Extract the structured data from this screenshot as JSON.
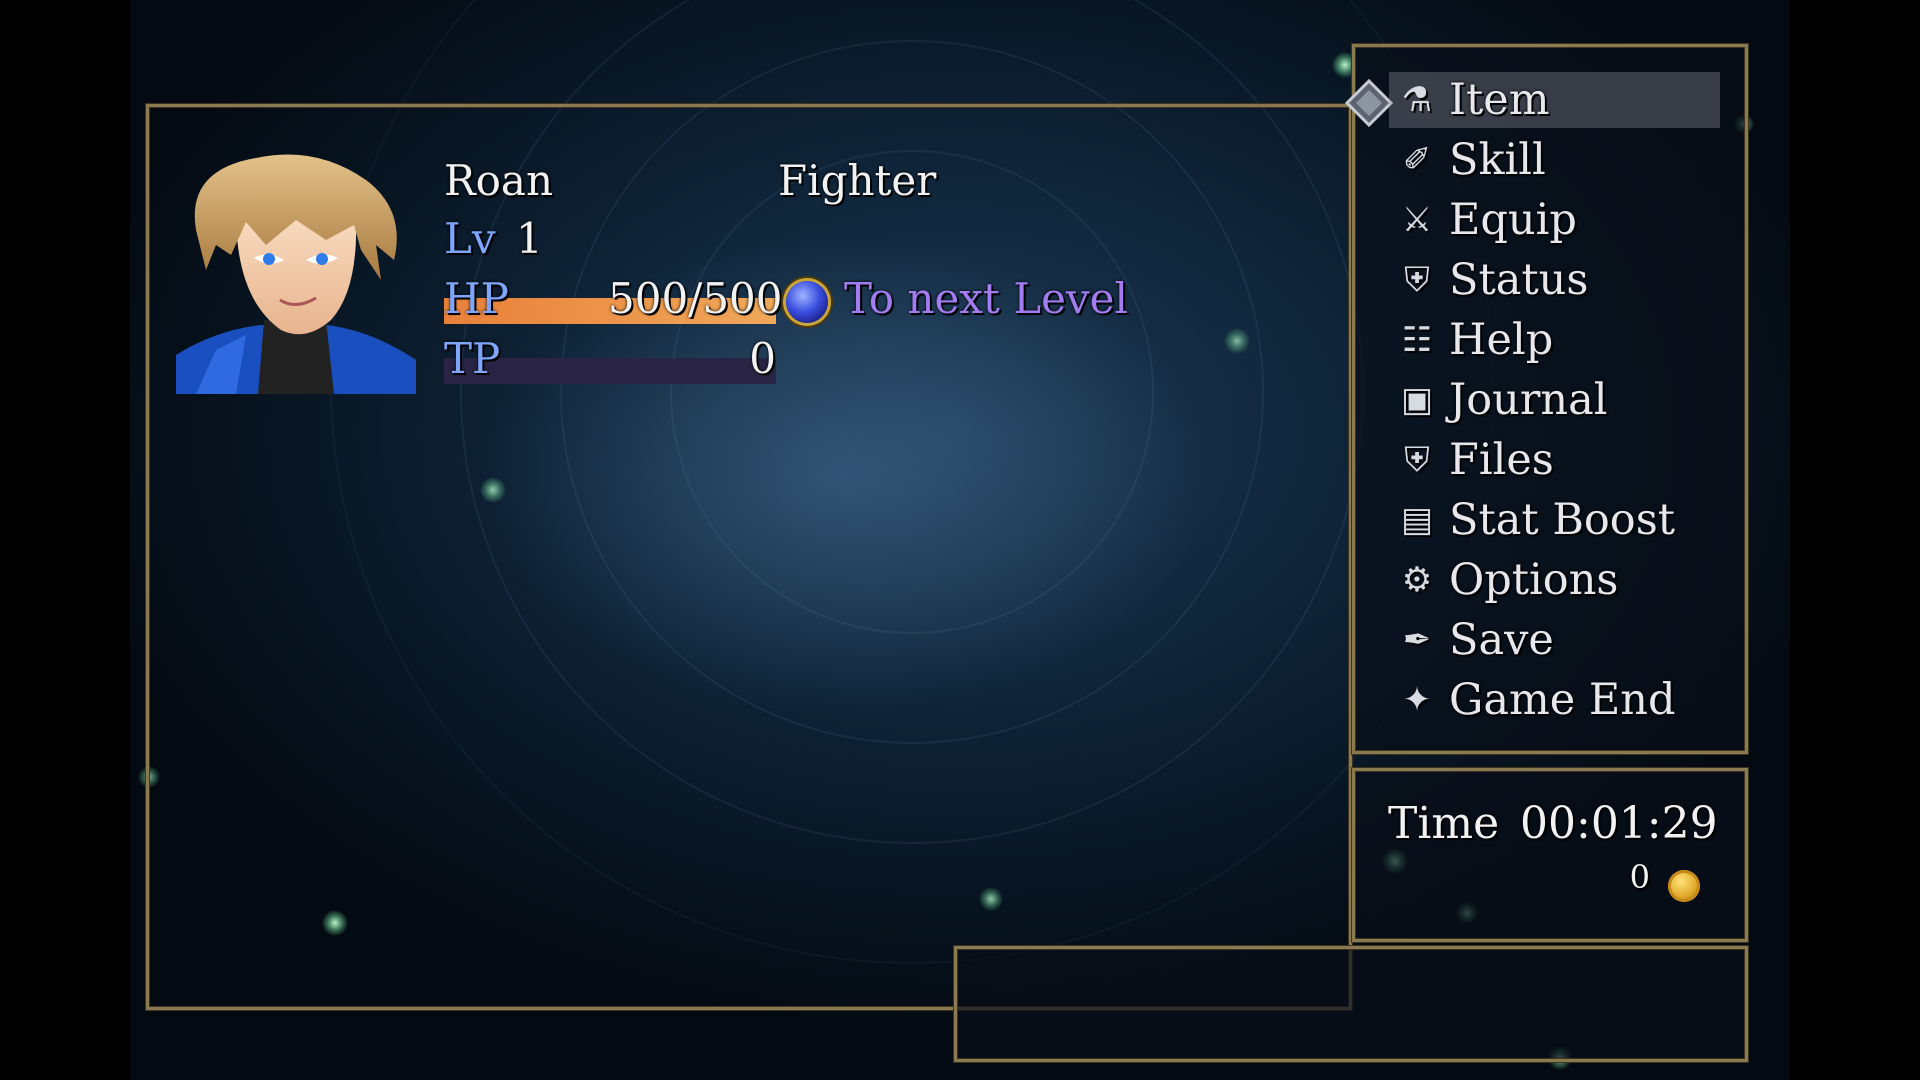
{
  "character": {
    "name": "Roan",
    "class": "Fighter",
    "level_label": "Lv",
    "level": "1",
    "hp_label": "HP",
    "hp_value": "500/500",
    "hp_fraction": 1.0,
    "tp_label": "TP",
    "tp_value": "0",
    "tp_fraction": 0.0,
    "next_level_text": "To next Level"
  },
  "menu": {
    "selected_index": 0,
    "items": [
      {
        "label": "Item",
        "icon": "potion-icon"
      },
      {
        "label": "Skill",
        "icon": "scroll-icon"
      },
      {
        "label": "Equip",
        "icon": "armor-icon"
      },
      {
        "label": "Status",
        "icon": "shield-icon"
      },
      {
        "label": "Help",
        "icon": "book-icon"
      },
      {
        "label": "Journal",
        "icon": "journal-icon"
      },
      {
        "label": "Files",
        "icon": "shield-icon"
      },
      {
        "label": "Stat Boost",
        "icon": "tome-icon"
      },
      {
        "label": "Options",
        "icon": "gear-icon"
      },
      {
        "label": "Save",
        "icon": "quill-icon"
      },
      {
        "label": "Game End",
        "icon": "compass-icon"
      }
    ]
  },
  "info": {
    "time_label": "Time",
    "time_value": "00:01:29",
    "gold_value": "0"
  },
  "colors": {
    "frame": "#8b7a50",
    "hp_bar": "#e8944a",
    "tp_bar": "#2a2444",
    "stat_label": "#7fa6ff",
    "next_level_text": "#a27cf0",
    "menu_highlight": "#7a7a82"
  }
}
